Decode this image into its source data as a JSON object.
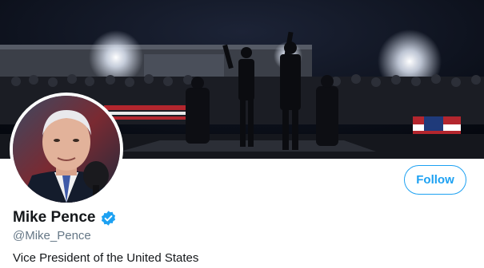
{
  "profile": {
    "display_name": "Mike Pence",
    "handle": "@Mike_Pence",
    "bio": "Vice President of the United States",
    "verified": true
  },
  "actions": {
    "follow_label": "Follow"
  },
  "icons": {
    "verified": "verified-badge-icon"
  },
  "colors": {
    "accent": "#1da1f2",
    "name_text": "#14171a",
    "secondary_text": "#657786"
  }
}
